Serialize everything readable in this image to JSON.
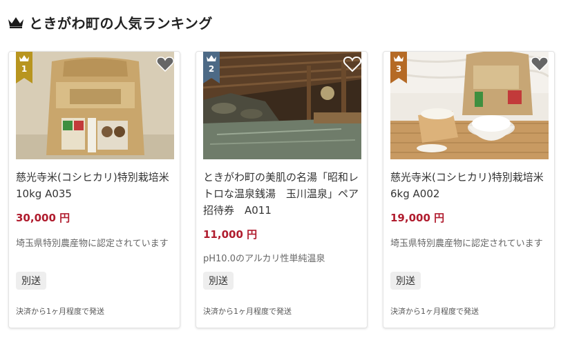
{
  "header": {
    "title": "ときがわ町の人気ランキング",
    "icon": "crown-icon",
    "icon_color": "#1a1a1a"
  },
  "cards": [
    {
      "rank": "1",
      "rank_color": "#b8951f",
      "title": "慈光寺米(コシヒカリ)特別栽培米10kg A035",
      "price": "30,000 円",
      "description": "埼玉県特別農産物に認定されています",
      "tag": "別送",
      "shipping": "決済から1ヶ月程度で発送",
      "favorite_icon": "heart-icon",
      "image": "rice-bag-photo"
    },
    {
      "rank": "2",
      "rank_color": "#4d6a86",
      "title": "ときがわ町の美肌の名湯「昭和レトロな温泉銭湯　玉川温泉」ペア招待券　A011",
      "price": "11,000 円",
      "description": "pH10.0のアルカリ性単純温泉",
      "tag": "別送",
      "shipping": "決済から1ヶ月程度で発送",
      "favorite_icon": "heart-outline-icon",
      "image": "hot-spring-photo"
    },
    {
      "rank": "3",
      "rank_color": "#b56a25",
      "title": "慈光寺米(コシヒカリ)特別栽培米6kg A002",
      "price": "19,000 円",
      "description": "埼玉県特別農産物に認定されています",
      "tag": "別送",
      "shipping": "決済から1ヶ月程度で発送",
      "favorite_icon": "heart-icon",
      "image": "rice-bowl-photo"
    }
  ]
}
